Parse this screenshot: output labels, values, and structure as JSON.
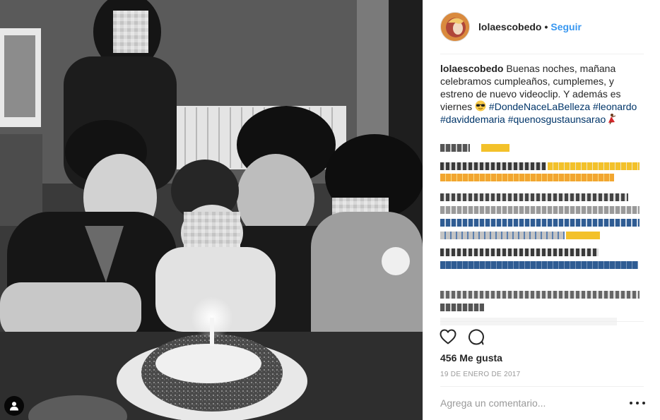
{
  "post": {
    "username": "lolaescobedo",
    "separator": "•",
    "follow_label": "Seguir",
    "avatar_description": "profile-photo"
  },
  "caption": {
    "username": "lolaescobedo",
    "text": "Buenas noches, mañana celebramos cumpleaños, cumplemes, y estreno de nuevo videoclip. Y además es viernes",
    "emoji": "sunglasses-emoji",
    "hashtags": [
      "#DondeNaceLaBelleza",
      "#leonardo",
      "#daviddemaria",
      "#quenosgustaunsarao"
    ],
    "trailing_emoji": "dancer-emoji"
  },
  "comments_note": "pixelated comments (unreadable)",
  "actions": {
    "like_icon": "heart-icon",
    "comment_icon": "comment-bubble-icon"
  },
  "likes": "456 Me gusta",
  "date": "19 DE ENERO DE 2017",
  "comment_box": {
    "placeholder": "Agrega un comentario..."
  },
  "colors": {
    "accent": "#3897f0",
    "hashtag": "#003569",
    "muted": "#999999",
    "text": "#262626"
  }
}
